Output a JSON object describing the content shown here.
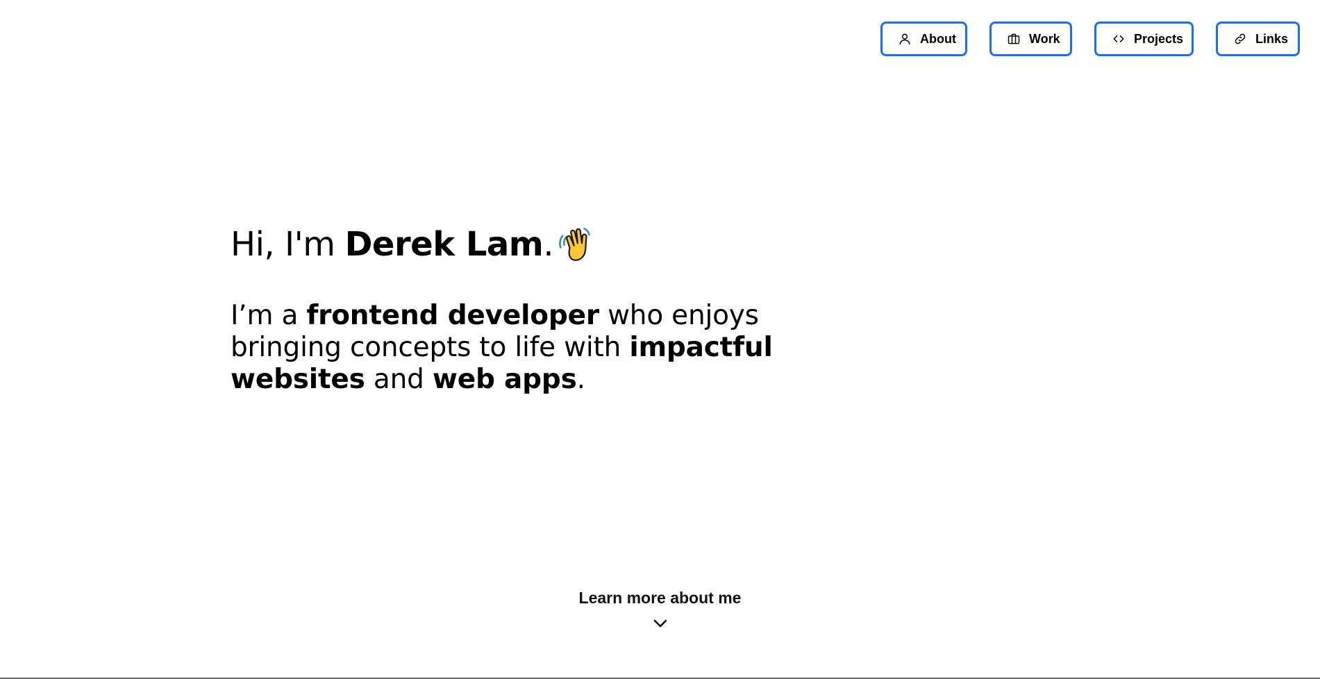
{
  "nav": {
    "items": [
      {
        "label": "About",
        "icon": "person-icon"
      },
      {
        "label": "Work",
        "icon": "briefcase-icon"
      },
      {
        "label": "Projects",
        "icon": "code-icon"
      },
      {
        "label": "Links",
        "icon": "link-icon"
      }
    ],
    "accent_color": "#1a6ef0"
  },
  "hero": {
    "greeting_prefix": "Hi, I'm",
    "name": "Derek Lam",
    "greeting_suffix": ".",
    "wave_icon": "waving-hand-icon",
    "intro": {
      "part1": "I’m a ",
      "bold1": "frontend developer",
      "part2": " who enjoys bringing concepts to life with ",
      "bold2": "impactful websites",
      "part3": " and ",
      "bold3": "web apps",
      "part4": "."
    }
  },
  "learn_more": {
    "label": "Learn more about me",
    "icon": "chevron-down-icon"
  }
}
